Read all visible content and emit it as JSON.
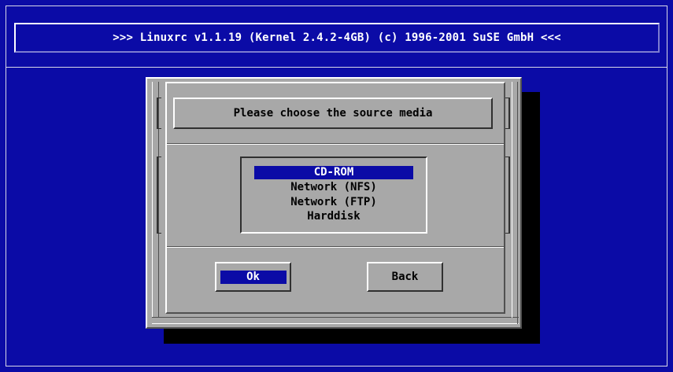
{
  "header": {
    "title": ">>> Linuxrc v1.1.19 (Kernel 2.4.2-4GB) (c) 1996-2001 SuSE GmbH <<<"
  },
  "dialog": {
    "title": "Please choose the source media",
    "options": [
      "CD-ROM",
      "Network (NFS)",
      "Network (FTP)",
      "Harddisk"
    ],
    "selected_option": "CD-ROM",
    "buttons": {
      "ok_label": "Ok",
      "back_label": "Back"
    }
  },
  "colors": {
    "screen_bg": "#0b0ba6",
    "dialog_bg": "#a8a8a8",
    "highlight": "#0b0ba6",
    "text_light": "#ffffff",
    "text_dark": "#000000"
  }
}
